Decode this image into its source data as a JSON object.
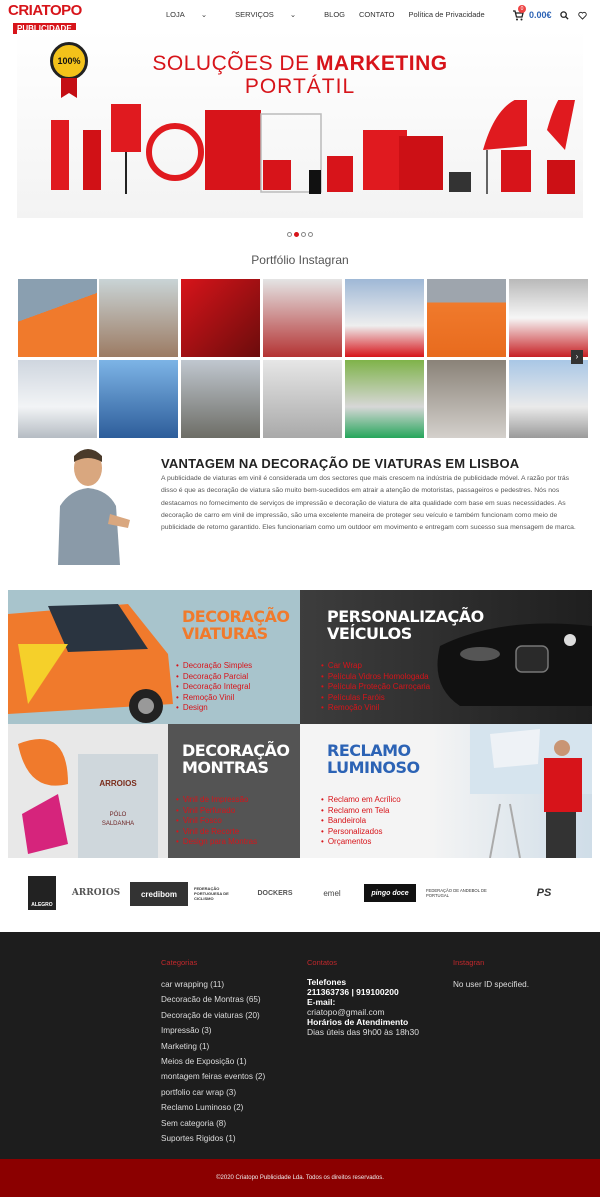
{
  "header": {
    "logo_top": "CRIATOPO",
    "logo_bottom": "PUBLICIDADE",
    "nav": [
      "LOJA",
      "SERVIÇOS",
      "BLOG",
      "CONTATO",
      "Política de Privacidade"
    ],
    "cart_count": "0",
    "cart_total": "0.00€"
  },
  "hero": {
    "title_pre": "SOLUÇÕES DE ",
    "title_bold": "MARKETING",
    "title_line2": "PORTÁTIL",
    "badge": "100%",
    "brand": "CRIATOPO",
    "active_slide": 2,
    "slide_count": 4
  },
  "portfolio": {
    "title": "Portfólio Instagran"
  },
  "vantagem": {
    "title": "VANTAGEM NA DECORAÇÃO DE VIATURAS EM LISBOA",
    "text": "A publicidade de viaturas em vinil é considerada um dos sectores que mais crescem na indústria de publicidade móvel. A razão por trás disso é que as decoração de viatura são muito bem-sucedidos em atrair a atenção de motoristas, passageiros e pedestres. Nós nos destacamos no fornecimento de serviços de impressão e decoração de viatura de alta qualidade com base em suas necessidades. As decoração de carro em vinil de impressão, são uma excelente maneira de proteger seu veículo e também funcionam como meio de publicidade de retorno garantido. Eles funcionariam como um outdoor em movimento e entregam com sucesso sua mensagem de marca."
  },
  "services": [
    {
      "title_l1": "DECORAÇÃO",
      "title_l2": "VIATURAS",
      "items": [
        "Decoração Simples",
        "Decoração Parcial",
        "Decoração Integral",
        "Remoção Vinil",
        "Design"
      ]
    },
    {
      "title_l1": "PERSONALIZAÇÃO",
      "title_l2": "VEÍCULOS",
      "items": [
        "Car Wrap",
        "Película Vidros Homologada",
        "Película Proteção Carroçaria",
        "Películas Faróis",
        "Remoção Vinil"
      ]
    },
    {
      "title_l1": "DECORAÇÃO",
      "title_l2": "MONTRAS",
      "items": [
        "Vinil de Impressão",
        "Vinil Perfurado",
        "Vinil Fosco",
        "Vinil de Recorte",
        "Design para Montras"
      ]
    },
    {
      "title_l1": "RECLAMO",
      "title_l2": "LUMINOSO",
      "items": [
        "Reclamo em Acrílico",
        "Reclamo em Tela",
        "Bandeirola",
        "Personalizados",
        "Orçamentos"
      ]
    }
  ],
  "montras_sign": {
    "l1": "ARROIOS",
    "l2": "PÓLO",
    "l3": "SALDANHA"
  },
  "partners": [
    "ALEGRO",
    "ARROIOS",
    "credibom",
    "FEDERAÇÃO PORTUGUESA DE CICLISMO",
    "DOCKERS",
    "emel",
    "pingo doce",
    "FEDERAÇÃO DE ANDEBOL DE PORTUGAL",
    "PS"
  ],
  "footer": {
    "categories_title": "Categorias",
    "categories": [
      "car wrapping (11)",
      "Decoracão de Montras (65)",
      "Decoração de viaturas (20)",
      "Impressão (3)",
      "Marketing (1)",
      "Meios de Exposição (1)",
      "montagem feiras eventos (2)",
      "portfolio car wrap (3)",
      "Reclamo Luminoso (2)",
      "Sem categoria (8)",
      "Suportes Rigidos (1)"
    ],
    "contacts_title": "Contatos",
    "phone_label": "Telefones",
    "phone_value": "211363736 | 919100200",
    "email_label": "E-mail:",
    "email_value": "criatopo@gmail.com",
    "hours_label": "Horários de Atendimento",
    "hours_value": "Dias úteis das 9h00 às 18h30",
    "instagram_title": "Instagran",
    "instagram_text": "No user ID specified.",
    "copyright": "©2020 Criatopo Publicidade Lda. Todos os direitos reservados."
  },
  "colors": {
    "brand_red": "#d7141a",
    "accent_orange": "#f07a2c",
    "accent_blue": "#2c63b5",
    "footer_bg": "#1d1d1d",
    "copy_bar": "#8b0000"
  }
}
